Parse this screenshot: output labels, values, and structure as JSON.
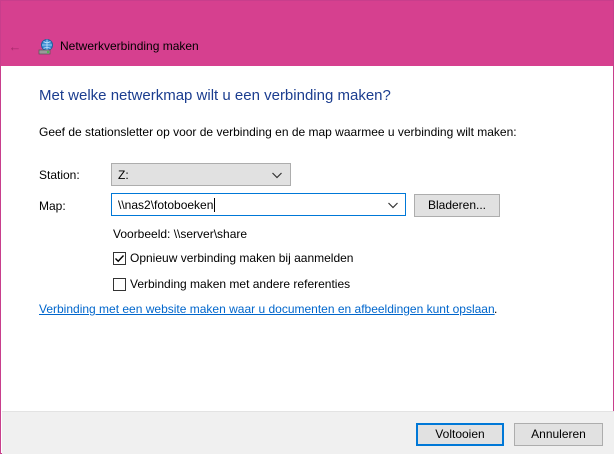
{
  "window": {
    "title": "Netwerkverbinding maken",
    "accent_color": "#d6408f"
  },
  "icons": {
    "back": "back-arrow-icon",
    "app": "network-drive-icon",
    "dropdown": "chevron-down-icon",
    "check": "checkmark-icon"
  },
  "heading": "Met welke netwerkmap wilt u een verbinding maken?",
  "instruction": "Geef de stationsletter op voor de verbinding en de map waarmee u verbinding wilt maken:",
  "station": {
    "label": "Station:",
    "value": "Z:"
  },
  "map": {
    "label": "Map:",
    "value": "\\\\nas2\\fotoboeken",
    "browse_label": "Bladeren..."
  },
  "example": "Voorbeeld: \\\\server\\share",
  "options": [
    {
      "label": "Opnieuw verbinding maken bij aanmelden",
      "checked": true
    },
    {
      "label": "Verbinding maken met andere referenties",
      "checked": false
    }
  ],
  "website_link": "Verbinding met een website maken waar u documenten en afbeeldingen kunt opslaan",
  "website_link_suffix": ".",
  "footer": {
    "finish_label": "Voltooien",
    "cancel_label": "Annuleren"
  }
}
